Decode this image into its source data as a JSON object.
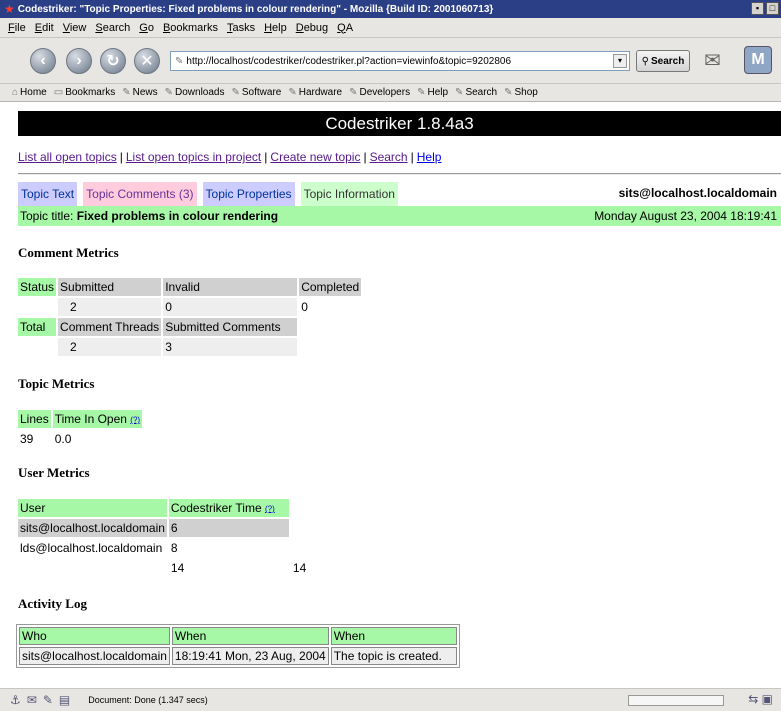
{
  "window": {
    "title": "Codestriker: \"Topic Properties: Fixed problems in colour rendering\" - Mozilla {Build ID: 2001060713}"
  },
  "menu": [
    "File",
    "Edit",
    "View",
    "Search",
    "Go",
    "Bookmarks",
    "Tasks",
    "Help",
    "Debug",
    "QA"
  ],
  "navbar": {
    "url": "http://localhost/codestriker/codestriker.pl?action=viewinfo&topic=9202806",
    "search_label": "Search"
  },
  "bookmarks": [
    "Home",
    "Bookmarks",
    "News",
    "Downloads",
    "Software",
    "Hardware",
    "Developers",
    "Help",
    "Search",
    "Shop"
  ],
  "page": {
    "app_title": "Codestriker 1.8.4a3",
    "links": [
      "List all open topics",
      "List open topics in project",
      "Create new topic",
      "Search",
      "Help"
    ],
    "tabs": [
      "Topic Text",
      "Topic Comments (3)",
      "Topic Properties",
      "Topic Information"
    ],
    "user": "sits@localhost.localdomain",
    "topic_title_label": "Topic title:",
    "topic_title": "Fixed problems in colour rendering",
    "topic_date": "Monday August 23, 2004 18:19:41"
  },
  "comment_metrics": {
    "heading": "Comment Metrics",
    "status_label": "Status",
    "status_headers": [
      "Submitted",
      "Invalid",
      "Completed"
    ],
    "status_values": [
      "2",
      "0",
      "0"
    ],
    "total_label": "Total",
    "total_headers": [
      "Comment Threads",
      "Submitted Comments"
    ],
    "total_values": [
      "2",
      "3"
    ]
  },
  "topic_metrics": {
    "heading": "Topic Metrics",
    "headers": [
      "Lines",
      "Time In Open"
    ],
    "help_icon": "(?)",
    "values": [
      "39",
      "0.0"
    ]
  },
  "user_metrics": {
    "heading": "User Metrics",
    "headers": [
      "User",
      "Codestriker Time"
    ],
    "help_icon": "(?)",
    "rows": [
      {
        "user": "sits@localhost.localdomain",
        "time": "6"
      },
      {
        "user": "lds@localhost.localdomain",
        "time": "8"
      }
    ],
    "totals": [
      "14",
      "14"
    ]
  },
  "activity_log": {
    "heading": "Activity Log",
    "headers": [
      "Who",
      "When",
      "When"
    ],
    "rows": [
      {
        "who": "sits@localhost.localdomain",
        "when": "18:19:41 Mon, 23 Aug, 2004",
        "what": "The topic is created."
      }
    ]
  },
  "status_bar": {
    "text": "Document: Done (1.347 secs)"
  }
}
